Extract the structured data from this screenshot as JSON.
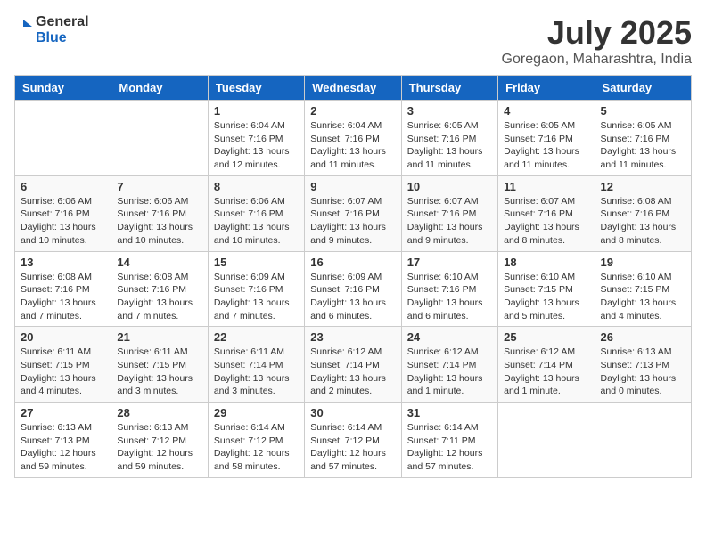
{
  "logo": {
    "general": "General",
    "blue": "Blue"
  },
  "title": "July 2025",
  "location": "Goregaon, Maharashtra, India",
  "weekdays": [
    "Sunday",
    "Monday",
    "Tuesday",
    "Wednesday",
    "Thursday",
    "Friday",
    "Saturday"
  ],
  "weeks": [
    [
      {
        "day": "",
        "info": ""
      },
      {
        "day": "",
        "info": ""
      },
      {
        "day": "1",
        "info": "Sunrise: 6:04 AM\nSunset: 7:16 PM\nDaylight: 13 hours and 12 minutes."
      },
      {
        "day": "2",
        "info": "Sunrise: 6:04 AM\nSunset: 7:16 PM\nDaylight: 13 hours and 11 minutes."
      },
      {
        "day": "3",
        "info": "Sunrise: 6:05 AM\nSunset: 7:16 PM\nDaylight: 13 hours and 11 minutes."
      },
      {
        "day": "4",
        "info": "Sunrise: 6:05 AM\nSunset: 7:16 PM\nDaylight: 13 hours and 11 minutes."
      },
      {
        "day": "5",
        "info": "Sunrise: 6:05 AM\nSunset: 7:16 PM\nDaylight: 13 hours and 11 minutes."
      }
    ],
    [
      {
        "day": "6",
        "info": "Sunrise: 6:06 AM\nSunset: 7:16 PM\nDaylight: 13 hours and 10 minutes."
      },
      {
        "day": "7",
        "info": "Sunrise: 6:06 AM\nSunset: 7:16 PM\nDaylight: 13 hours and 10 minutes."
      },
      {
        "day": "8",
        "info": "Sunrise: 6:06 AM\nSunset: 7:16 PM\nDaylight: 13 hours and 10 minutes."
      },
      {
        "day": "9",
        "info": "Sunrise: 6:07 AM\nSunset: 7:16 PM\nDaylight: 13 hours and 9 minutes."
      },
      {
        "day": "10",
        "info": "Sunrise: 6:07 AM\nSunset: 7:16 PM\nDaylight: 13 hours and 9 minutes."
      },
      {
        "day": "11",
        "info": "Sunrise: 6:07 AM\nSunset: 7:16 PM\nDaylight: 13 hours and 8 minutes."
      },
      {
        "day": "12",
        "info": "Sunrise: 6:08 AM\nSunset: 7:16 PM\nDaylight: 13 hours and 8 minutes."
      }
    ],
    [
      {
        "day": "13",
        "info": "Sunrise: 6:08 AM\nSunset: 7:16 PM\nDaylight: 13 hours and 7 minutes."
      },
      {
        "day": "14",
        "info": "Sunrise: 6:08 AM\nSunset: 7:16 PM\nDaylight: 13 hours and 7 minutes."
      },
      {
        "day": "15",
        "info": "Sunrise: 6:09 AM\nSunset: 7:16 PM\nDaylight: 13 hours and 7 minutes."
      },
      {
        "day": "16",
        "info": "Sunrise: 6:09 AM\nSunset: 7:16 PM\nDaylight: 13 hours and 6 minutes."
      },
      {
        "day": "17",
        "info": "Sunrise: 6:10 AM\nSunset: 7:16 PM\nDaylight: 13 hours and 6 minutes."
      },
      {
        "day": "18",
        "info": "Sunrise: 6:10 AM\nSunset: 7:15 PM\nDaylight: 13 hours and 5 minutes."
      },
      {
        "day": "19",
        "info": "Sunrise: 6:10 AM\nSunset: 7:15 PM\nDaylight: 13 hours and 4 minutes."
      }
    ],
    [
      {
        "day": "20",
        "info": "Sunrise: 6:11 AM\nSunset: 7:15 PM\nDaylight: 13 hours and 4 minutes."
      },
      {
        "day": "21",
        "info": "Sunrise: 6:11 AM\nSunset: 7:15 PM\nDaylight: 13 hours and 3 minutes."
      },
      {
        "day": "22",
        "info": "Sunrise: 6:11 AM\nSunset: 7:14 PM\nDaylight: 13 hours and 3 minutes."
      },
      {
        "day": "23",
        "info": "Sunrise: 6:12 AM\nSunset: 7:14 PM\nDaylight: 13 hours and 2 minutes."
      },
      {
        "day": "24",
        "info": "Sunrise: 6:12 AM\nSunset: 7:14 PM\nDaylight: 13 hours and 1 minute."
      },
      {
        "day": "25",
        "info": "Sunrise: 6:12 AM\nSunset: 7:14 PM\nDaylight: 13 hours and 1 minute."
      },
      {
        "day": "26",
        "info": "Sunrise: 6:13 AM\nSunset: 7:13 PM\nDaylight: 13 hours and 0 minutes."
      }
    ],
    [
      {
        "day": "27",
        "info": "Sunrise: 6:13 AM\nSunset: 7:13 PM\nDaylight: 12 hours and 59 minutes."
      },
      {
        "day": "28",
        "info": "Sunrise: 6:13 AM\nSunset: 7:12 PM\nDaylight: 12 hours and 59 minutes."
      },
      {
        "day": "29",
        "info": "Sunrise: 6:14 AM\nSunset: 7:12 PM\nDaylight: 12 hours and 58 minutes."
      },
      {
        "day": "30",
        "info": "Sunrise: 6:14 AM\nSunset: 7:12 PM\nDaylight: 12 hours and 57 minutes."
      },
      {
        "day": "31",
        "info": "Sunrise: 6:14 AM\nSunset: 7:11 PM\nDaylight: 12 hours and 57 minutes."
      },
      {
        "day": "",
        "info": ""
      },
      {
        "day": "",
        "info": ""
      }
    ]
  ]
}
